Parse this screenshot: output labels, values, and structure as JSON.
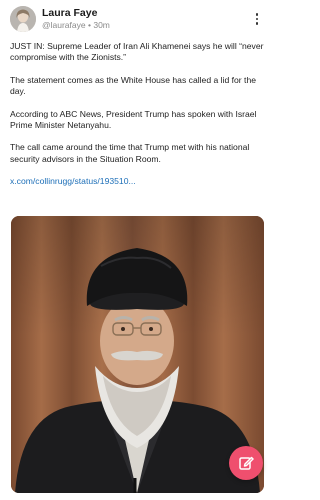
{
  "author": {
    "name": "Laura Faye",
    "handle": "@laurafaye",
    "separator": "•",
    "time": "30m"
  },
  "post": {
    "paragraphs": [
      "JUST IN: Supreme Leader of Iran Ali Khamenei says he will “never compromise with the Zionists.”",
      "The statement comes as the White House has called a lid for the day.",
      "According to ABC News, President Trump has spoken with Israel Prime Minister Netanyahu.",
      "The call came around the time that Trump met with his national security advisors in the Situation Room."
    ],
    "link_text": "x.com/collinrugg/status/193510..."
  },
  "icons": {
    "more": "more-vertical-icon",
    "compose": "edit-icon"
  },
  "colors": {
    "accent": "#ef4f6e",
    "link": "#1d6fb8",
    "muted": "#8a8a8a"
  }
}
